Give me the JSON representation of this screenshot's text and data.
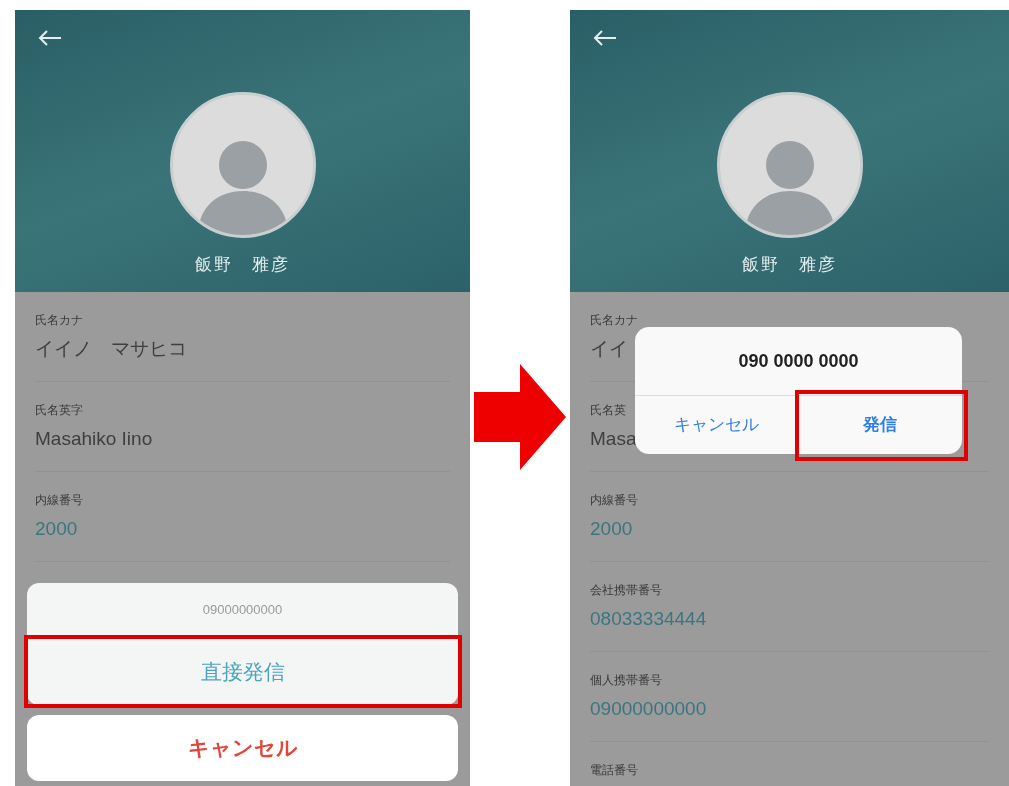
{
  "screens": [
    {
      "header": {
        "name": "飯野　雅彦"
      },
      "fields": [
        {
          "label": "氏名カナ",
          "value": "イイノ　マサヒコ",
          "kind": "text"
        },
        {
          "label": "氏名英字",
          "value": "Masahiko Iino",
          "kind": "text"
        },
        {
          "label": "内線番号",
          "value": "2000",
          "kind": "phone"
        }
      ],
      "dialog": {
        "kind": "action_sheet",
        "title": "09000000000",
        "buttons": [
          {
            "label": "直接発信",
            "kind": "default",
            "highlighted": true
          },
          {
            "label": "キャンセル",
            "kind": "cancel",
            "highlighted": false
          }
        ]
      }
    },
    {
      "header": {
        "name": "飯野　雅彦"
      },
      "fields": [
        {
          "label": "氏名カナ",
          "value": "イイ",
          "kind": "text"
        },
        {
          "label": "氏名英",
          "value": "Masa",
          "kind": "text"
        },
        {
          "label": "内線番号",
          "value": "2000",
          "kind": "phone"
        },
        {
          "label": "会社携帯番号",
          "value": "08033334444",
          "kind": "phone"
        },
        {
          "label": "個人携帯番号",
          "value": "09000000000",
          "kind": "phone"
        },
        {
          "label": "電話番号"
        }
      ],
      "dialog": {
        "kind": "alert",
        "title": "090 0000 0000",
        "buttons": [
          {
            "label": "キャンセル",
            "kind": "cancel",
            "highlighted": false
          },
          {
            "label": "発信",
            "kind": "default",
            "highlighted": true
          }
        ]
      }
    }
  ]
}
